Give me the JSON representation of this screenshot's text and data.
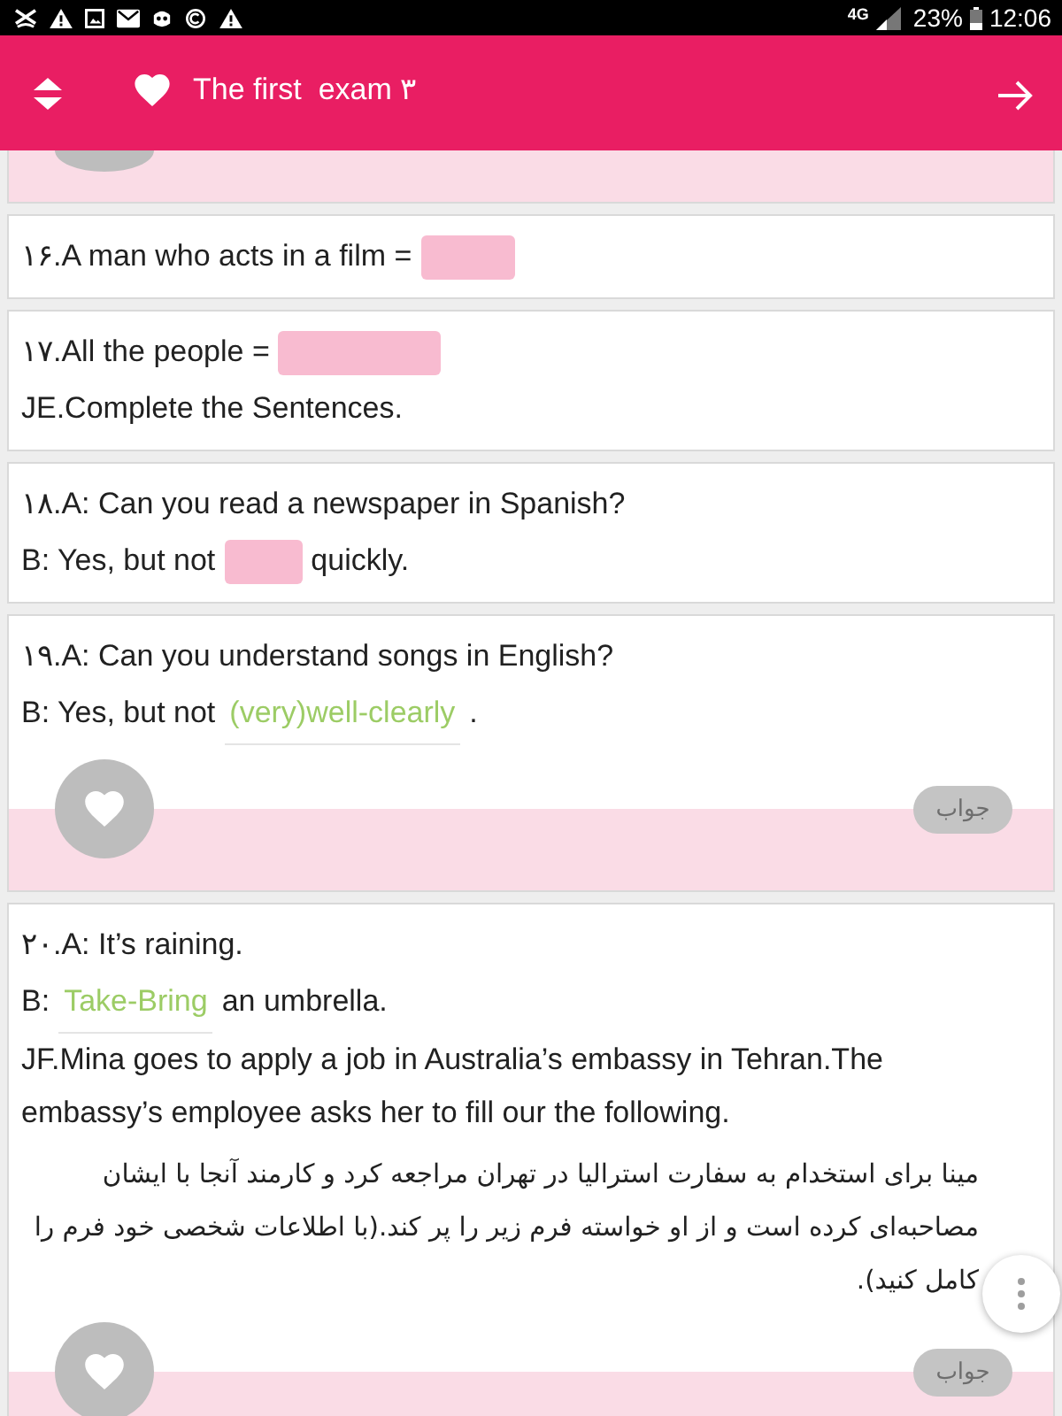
{
  "status_bar": {
    "network": "4G",
    "battery": "23%",
    "time": "12:06"
  },
  "header": {
    "title": "The first  exam ۳"
  },
  "cards": [
    {
      "kind": "cut_off"
    },
    {
      "kind": "question",
      "lines": [
        {
          "kind": "blank_sentence",
          "before": "۱۶.A man who acts in a film ="
        }
      ]
    },
    {
      "kind": "question",
      "lines": [
        {
          "kind": "blank_sentence",
          "before": "۱۷.All the people ="
        },
        {
          "kind": "sentence",
          "text": "JE.Complete the Sentences."
        }
      ]
    },
    {
      "kind": "question",
      "lines": [
        {
          "kind": "sentence",
          "text": "۱۸.A: Can you read a newspaper in Spanish?"
        },
        {
          "kind": "blank_sentence",
          "before": "B: Yes, but not",
          "after": "quickly."
        }
      ]
    },
    {
      "kind": "question",
      "lines": [
        {
          "kind": "sentence",
          "text": "۱۹.A: Can you understand songs in English?"
        },
        {
          "kind": "answer_sentence",
          "before": "B: Yes, but not",
          "answer": "(very)well-clearly",
          "after": "."
        }
      ],
      "answer_button": "جواب"
    },
    {
      "kind": "question",
      "lines": [
        {
          "kind": "sentence",
          "text": "۲۰.A: It’s raining."
        },
        {
          "kind": "answer_sentence",
          "before": "B:",
          "answer": "Take-Bring",
          "after": "an umbrella."
        },
        {
          "kind": "paragraph",
          "text": "JF.Mina goes to apply a job in Australia’s embassy in Tehran.The embassy’s employee asks her to fill our the following."
        },
        {
          "kind": "rtl_paragraph",
          "text": "مینا برای استخدام به سفارت استرالیا در تهران مراجعه کرد و کارمند آنجا با ایشان مصاحبه‌ای کرده است و از او خواسته فرم زیر را پر کند.(با اطلاعات شخصی خود فرم را کامل کنید)."
        }
      ],
      "answer_button": "جواب"
    }
  ]
}
